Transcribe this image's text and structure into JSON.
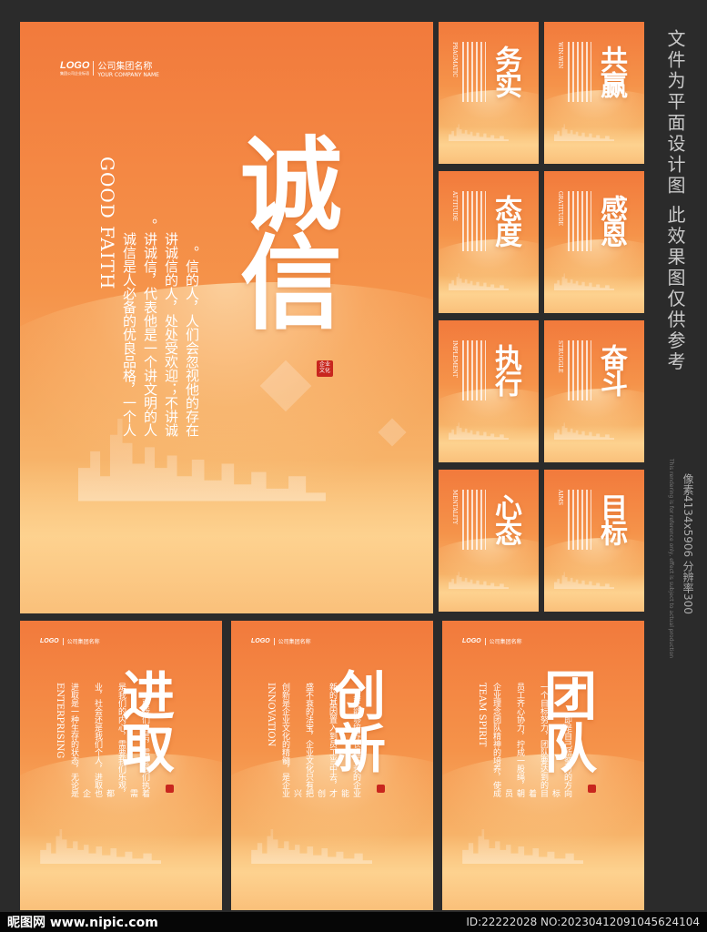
{
  "main": {
    "logo": "LOGO",
    "logo_sub": "集团公司企业标语",
    "company_cn": "公司集团名称",
    "company_en": "YOUR COMPANY NAME",
    "title": "诚信",
    "english": "GOOD FAITH",
    "body_lines": [
      "诚信是人必备的优良品格，一个人",
      "讲诚信，代表他是一个讲文明的人。",
      "讲诚信的人，处处受欢迎；不讲诚",
      "信的人，人们会忽视他的存在。"
    ],
    "seal": "企业文化"
  },
  "small_posters": [
    {
      "title": "务实",
      "english": "PRAGMATIC"
    },
    {
      "title": "共赢",
      "english": "WIN-WIN"
    },
    {
      "title": "态度",
      "english": "ATTITUDE"
    },
    {
      "title": "感恩",
      "english": "GRATITUDE"
    },
    {
      "title": "执行",
      "english": "IMPLEMENT"
    },
    {
      "title": "奋斗",
      "english": "STRUGGLE"
    },
    {
      "title": "心态",
      "english": "MENTALITY"
    },
    {
      "title": "目标",
      "english": "AIMS"
    }
  ],
  "bottom_posters": [
    {
      "logo": "LOGO",
      "company_cn": "公司集团名称",
      "title_1": "进",
      "title_2": "取",
      "english": "ENTERPRISING",
      "body_lines": [
        "进取是一种生存的状态，无论是企",
        "业，社会还是我们个人，进取也都",
        "是我们的内心，需要我们乐观，需",
        "要我们自信，需要我们执着。"
      ]
    },
    {
      "logo": "LOGO",
      "company_cn": "公司集团名称",
      "title_1": "创",
      "title_2": "新",
      "english": "INNOVATION",
      "body_lines": [
        "创新是企业文化的精髓，是企业兴",
        "盛不衰的法宝，企业文化只有把创",
        "新的基因置入到员工当中去，才能",
        "真正能够培养长盛不衰的企业。"
      ]
    },
    {
      "logo": "LOGO",
      "company_cn": "公司集团名称",
      "title_1": "团",
      "title_2": "队",
      "english": "TEAM SPIRIT",
      "body_lines": [
        "企业理念团队精神的培养，使成员",
        "员工齐心协力，拧成一股绳，朝着",
        "一个目标努力，团队要达到的目标",
        "即是自己所努力的方向。"
      ]
    }
  ],
  "side_note": "文件为平面设计图 此效果图仅供参考",
  "side_spec": "像素4134x5906 分辨率300",
  "side_small": "This rendering is for reference only, effect is subject to actual production",
  "watermark": {
    "brand": "昵图网 www.nipic.com",
    "id": "ID:22222028 NO:20230412091045624104"
  }
}
